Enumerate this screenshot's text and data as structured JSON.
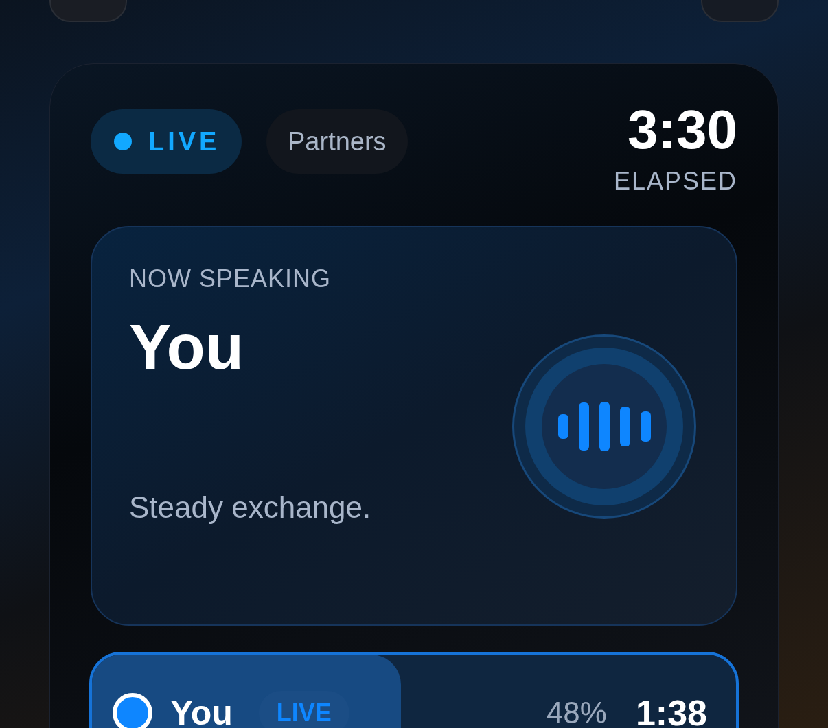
{
  "header": {
    "status": {
      "label": "LIVE"
    },
    "filter": {
      "label": "Partners"
    },
    "timer": {
      "value": "3:30",
      "caption": "ELAPSED"
    }
  },
  "now_speaking": {
    "heading": "NOW SPEAKING",
    "name": "You",
    "note": "Steady exchange."
  },
  "participants": [
    {
      "name": "You",
      "badge": "LIVE",
      "share": "48%",
      "time": "1:38",
      "level": 0.48,
      "selected": true
    }
  ]
}
